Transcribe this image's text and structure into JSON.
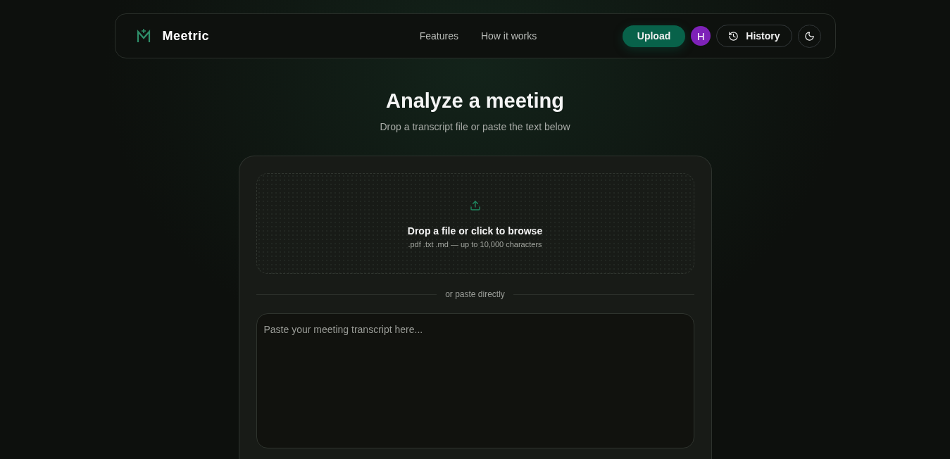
{
  "nav": {
    "brand": "Meetric",
    "links": [
      "Features",
      "How it works"
    ],
    "upload": "Upload",
    "avatar": "H",
    "history": "History"
  },
  "heading": {
    "title": "Analyze a meeting",
    "subtitle": "Drop a transcript file or paste the text below"
  },
  "dropzone": {
    "title": "Drop a file or click to browse",
    "hint": ".pdf .txt .md — up to 10,000 characters"
  },
  "divider": "or paste directly",
  "transcript": {
    "placeholder": "Paste your meeting transcript here..."
  }
}
